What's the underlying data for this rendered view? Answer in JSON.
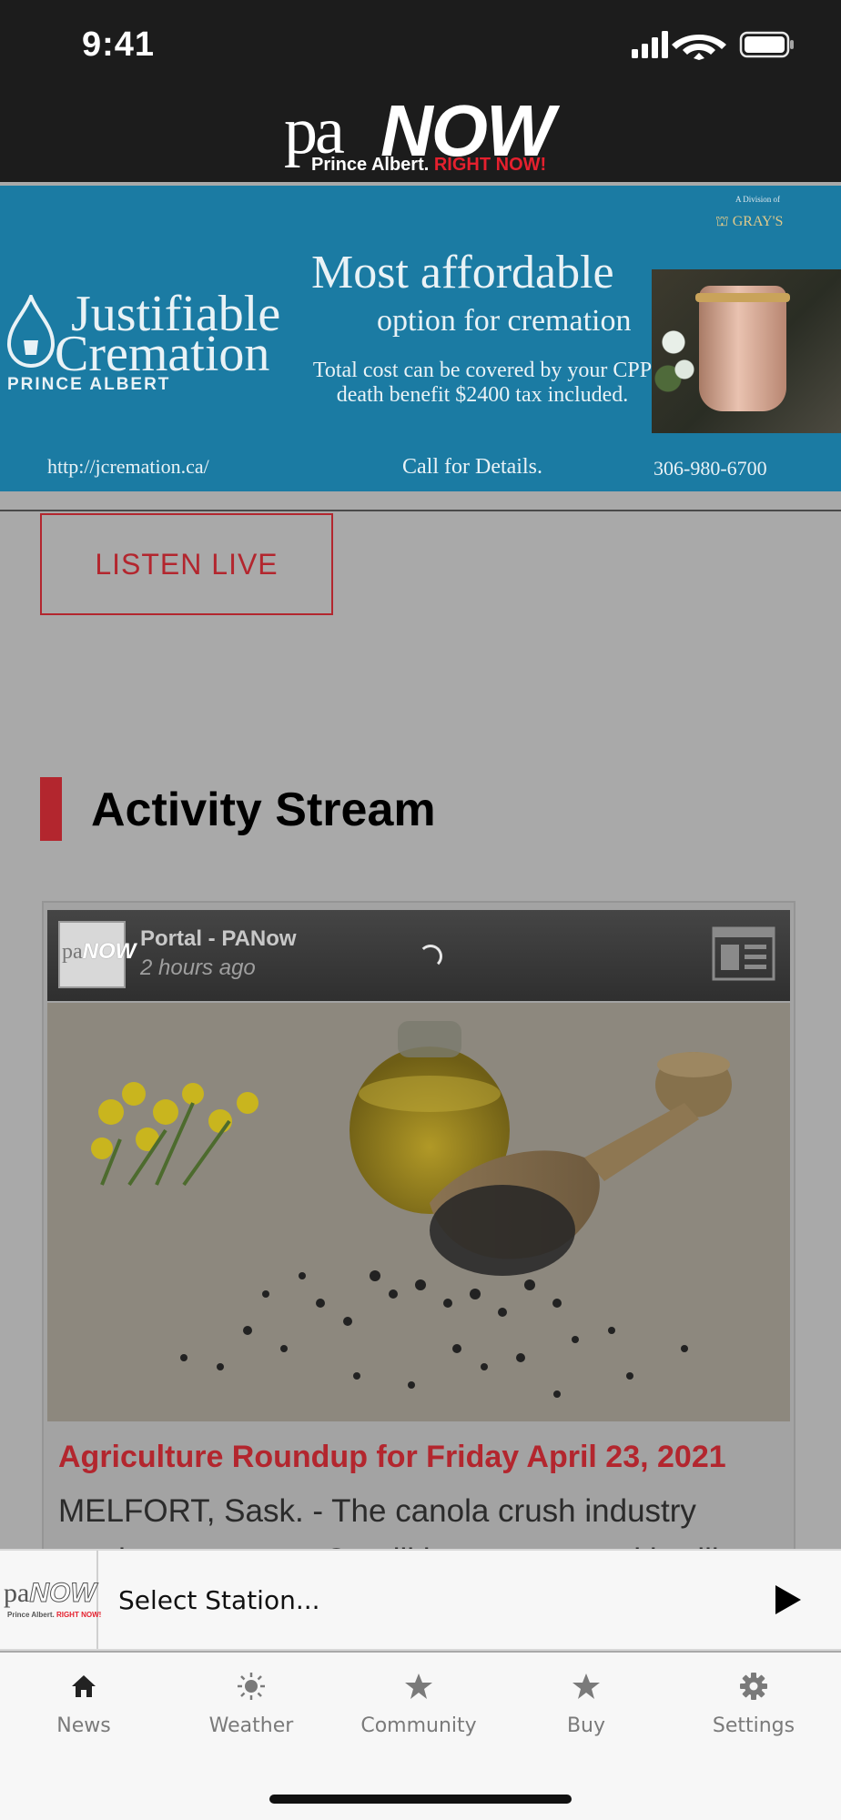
{
  "status_bar": {
    "time": "9:41"
  },
  "header": {
    "logo_pa": "pa",
    "logo_now": "NOW",
    "logo_tag_white": "Prince Albert.",
    "logo_tag_red": "RIGHT NOW!"
  },
  "ad": {
    "division_text": "A Division of",
    "grays": "GRAY'S",
    "brand_line1": "Justifiable",
    "brand_line2": "Cremation",
    "brand_sub": "PRINCE ALBERT",
    "headline": "Most affordable",
    "subheadline": "option for cremation",
    "body": "Total cost can be covered by your CPP death benefit $2400 tax included.",
    "url": "http://jcremation.ca/",
    "call": "Call for Details.",
    "phone": "306-980-6700",
    "bg_color": "#1b7ba3"
  },
  "listen_live": {
    "label": "LISTEN LIVE"
  },
  "section": {
    "title": "Activity Stream"
  },
  "card": {
    "author": "Portal - PANow",
    "time": "2 hours ago",
    "title": "Agriculture Roundup for Friday April 23, 2021",
    "description": "MELFORT, Sask. - The canola crush industry continues to grow. Cargill has announced it will",
    "avatar_pa": "pa",
    "avatar_now": "NOW"
  },
  "player": {
    "label": "Select Station...",
    "logo_pa": "pa",
    "logo_now": "NOW",
    "logo_tag_white": "Prince Albert.",
    "logo_tag_red": "RIGHT NOW!"
  },
  "tabs": [
    {
      "label": "News",
      "icon": "home-icon"
    },
    {
      "label": "Weather",
      "icon": "sun-icon"
    },
    {
      "label": "Community",
      "icon": "star-icon"
    },
    {
      "label": "Buy",
      "icon": "star-icon"
    },
    {
      "label": "Settings",
      "icon": "gear-icon"
    }
  ],
  "colors": {
    "accent": "#b3262e",
    "header_bg": "#1c1c1c"
  }
}
